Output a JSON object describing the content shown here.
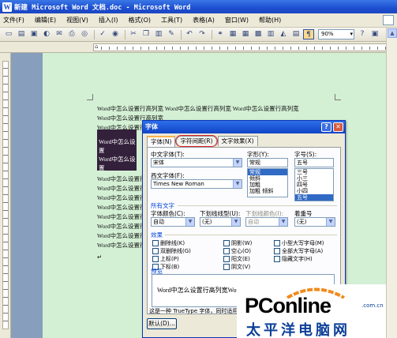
{
  "window": {
    "title": "新建 Microsoft Word 文档.doc - Microsoft Word",
    "app_icon": "W"
  },
  "menu": {
    "items": [
      "文件(F)",
      "编辑(E)",
      "视图(V)",
      "插入(I)",
      "格式(O)",
      "工具(T)",
      "表格(A)",
      "窗口(W)",
      "帮助(H)"
    ]
  },
  "toolbar": {
    "zoom": "90%"
  },
  "document": {
    "lines": [
      "Word中怎么设置行高列宽 Word中怎么设置行高列宽 Word中怎么设置行高列宽",
      "Word中怎么设置行高列宽",
      "Word中怎么设置行高列宽",
      "Word中怎么设置行高列宽",
      "Word中怎么设置行高列宽",
      "Word中怎么设置行高列宽",
      "Word中怎么设置行高列宽",
      "Word中怎么设置行高列宽",
      "Word中怎么设置行高列宽",
      "Word中怎么设置行高列宽",
      "Word中怎么设置行高列宽"
    ],
    "selected_lines": [
      "Word中怎么设置",
      "Word中怎么设置"
    ]
  },
  "dialog": {
    "title": "字体",
    "help": "?",
    "close": "✕",
    "tabs": [
      {
        "label": "字体(N)",
        "active": true
      },
      {
        "label": "字符间距(R)",
        "active": false,
        "highlighted": true
      },
      {
        "label": "文字效果(X)",
        "active": false
      }
    ],
    "chinese_font": {
      "label": "中文字体(T):",
      "value": "宋体"
    },
    "western_font": {
      "label": "西文字体(F):",
      "value": "Times New Roman"
    },
    "style": {
      "label": "字形(Y):",
      "value": "常规",
      "options": [
        "常规",
        "倾斜",
        "加粗",
        "加粗 倾斜"
      ],
      "selected": 0
    },
    "size": {
      "label": "字号(S):",
      "value": "五号",
      "options": [
        "三号",
        "小三",
        "四号",
        "小四",
        "五号"
      ],
      "selected": 4
    },
    "all_text": {
      "title": "所有文字"
    },
    "font_color": {
      "label": "字体颜色(C):",
      "value": "自动"
    },
    "underline_style": {
      "label": "下划线线型(U):",
      "value": "(无)"
    },
    "underline_color": {
      "label": "下划线颜色(I):",
      "value": "自动"
    },
    "emphasis": {
      "label": "着重号",
      "value": "(无)"
    },
    "effects": {
      "title": "效果",
      "items": [
        "删除线(K)",
        "双删除线(G)",
        "上标(P)",
        "下标(B)",
        "阴影(W)",
        "空心(O)",
        "阳文(E)",
        "阴文(V)",
        "小型大写字母(M)",
        "全部大写字母(A)",
        "隐藏文字(H)"
      ]
    },
    "preview": {
      "title": "预览",
      "text": "Word中怎么设置行高列宽Word中怎么设"
    },
    "footnote": "这是一种 TrueType 字体，同时适用",
    "default_button": "默认(D)..."
  },
  "watermark": {
    "brand": "PConline",
    "domain": ".com.cn",
    "chinese": "太平洋电脑网"
  }
}
